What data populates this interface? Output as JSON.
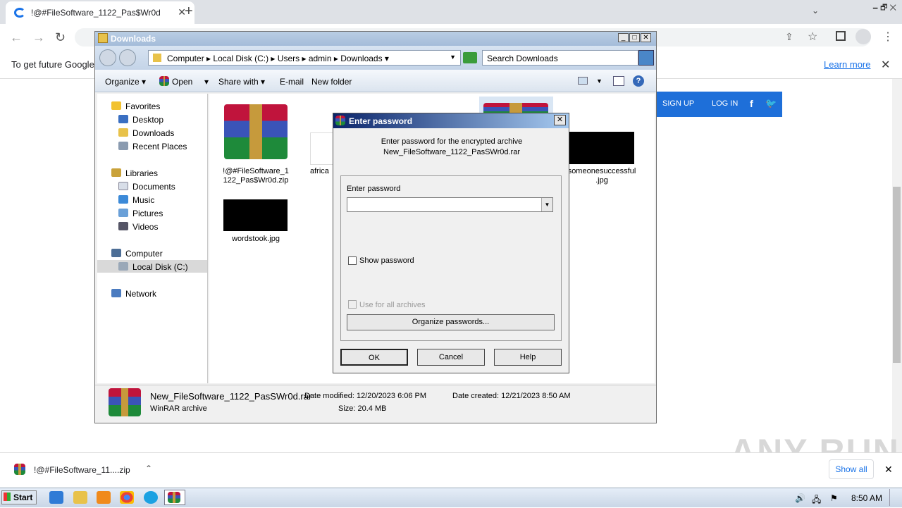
{
  "browser": {
    "tab_title": "!@#FileSoftware_1122_Pas$Wr0d",
    "new_tab": "+",
    "window_controls": "🗕 🗗 ✕",
    "info_text": "To get future Google",
    "learn_more": "Learn more",
    "close": "✕"
  },
  "page": {
    "sign_up": "SIGN UP",
    "log_in": "LOG IN"
  },
  "download": {
    "file_name": "!@#FileSoftware_11....zip",
    "show_all": "Show all"
  },
  "explorer": {
    "title": "Downloads",
    "breadcrumbs": [
      "Computer",
      "Local Disk (C:)",
      "Users",
      "admin",
      "Downloads"
    ],
    "search_placeholder": "Search Downloads",
    "commands": {
      "organize": "Organize",
      "open": "Open",
      "share_with": "Share with",
      "email": "E-mail",
      "new_folder": "New folder"
    },
    "nav": {
      "favorites": "Favorites",
      "desktop": "Desktop",
      "downloads": "Downloads",
      "recent_places": "Recent Places",
      "libraries": "Libraries",
      "documents": "Documents",
      "music": "Music",
      "pictures": "Pictures",
      "videos": "Videos",
      "computer": "Computer",
      "local_disk": "Local Disk (C:)",
      "network": "Network"
    },
    "files": [
      {
        "name": "!@#FileSoftware_1\n122_Pas$Wr0d.zip",
        "type": "rar"
      },
      {
        "name": "africa",
        "type": "blank"
      },
      {
        "name": "someonesuccessful\n.jpg",
        "type": "image"
      },
      {
        "name": "wordstook.jpg",
        "type": "image"
      }
    ],
    "status": {
      "file": "New_FileSoftware_1122_PasSWr0d.rar",
      "kind": "WinRAR archive",
      "modified": "Date modified:  12/20/2023 6:06 PM",
      "size": "Size:  20.4 MB",
      "created": "Date created:  12/21/2023 8:50 AM"
    }
  },
  "dialog": {
    "title": "Enter password",
    "message_line1": "Enter password for the encrypted archive",
    "message_line2": "New_FileSoftware_1122_PasSWr0d.rar",
    "field_label": "Enter password",
    "password_value": "",
    "show_password": "Show password",
    "use_for_all": "Use for all archives",
    "organize": "Organize passwords...",
    "ok": "OK",
    "cancel": "Cancel",
    "help": "Help"
  },
  "taskbar": {
    "start": "Start",
    "clock": "8:50 AM"
  },
  "watermark": "ANY RUN"
}
